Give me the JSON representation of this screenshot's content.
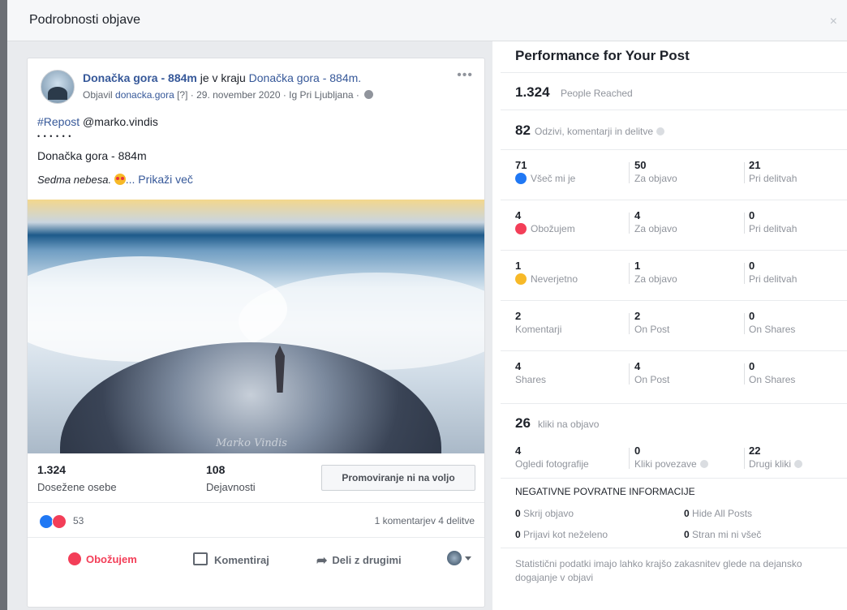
{
  "modal": {
    "title": "Podrobnosti objave",
    "close": "×"
  },
  "post": {
    "author": "Donačka gora - 884m",
    "connector": " je v kraju ",
    "place": "Donačka gora - 884m.",
    "published_by_prefix": "Objavil ",
    "published_by": "donacka.gora",
    "published_meta": " [?] · 29. november 2020 · Ig Pri Ljubljana · ",
    "more": "•••",
    "hashtag": "#Repost",
    "mention": " @marko.vindis",
    "dots": "• • • • • •",
    "line1": "Donačka gora - 884m",
    "italic": "Sedma nebesa. ",
    "see_more": "... Prikaži več",
    "watermark": "Marko Vindis",
    "reached_value": "1.324",
    "reached_label": "Dosežene osebe",
    "engagement_value": "108",
    "engagement_label": "Dejavnosti",
    "promote": "Promoviranje ni na voljo",
    "reaction_count": "53",
    "comments_shares": "1 komentarjev  4 delitve",
    "actions": {
      "love": "Obožujem",
      "comment": "Komentiraj",
      "share": "Deli z drugimi"
    }
  },
  "performance": {
    "title": "Performance for Your Post",
    "reached_value": "1.324",
    "reached_label": "People Reached",
    "engagement_value": "82",
    "engagement_label": "Odzivi, komentarji in delitve",
    "rows": [
      {
        "total": "71",
        "label": "Všeč mi je",
        "icon": "like",
        "post": "50",
        "post_label": "Za objavo",
        "shares": "21",
        "shares_label": "Pri delitvah"
      },
      {
        "total": "4",
        "label": "Obožujem",
        "icon": "love",
        "post": "4",
        "post_label": "Za objavo",
        "shares": "0",
        "shares_label": "Pri delitvah"
      },
      {
        "total": "1",
        "label": "Neverjetno",
        "icon": "wow",
        "post": "1",
        "post_label": "Za objavo",
        "shares": "0",
        "shares_label": "Pri delitvah"
      },
      {
        "total": "2",
        "label": "Komentarji",
        "icon": "",
        "post": "2",
        "post_label": "On Post",
        "shares": "0",
        "shares_label": "On Shares"
      },
      {
        "total": "4",
        "label": "Shares",
        "icon": "",
        "post": "4",
        "post_label": "On Post",
        "shares": "0",
        "shares_label": "On Shares"
      }
    ],
    "clicks_value": "26",
    "clicks_label": "kliki na objavo",
    "clicks": [
      {
        "n": "4",
        "l": "Ogledi fotografije"
      },
      {
        "n": "0",
        "l": "Kliki povezave"
      },
      {
        "n": "22",
        "l": "Drugi kliki"
      }
    ],
    "negative_title": "NEGATIVNE POVRATNE INFORMACIJE",
    "negative": [
      {
        "n": "0",
        "l": " Skrij objavo"
      },
      {
        "n": "0",
        "l": " Hide All Posts"
      },
      {
        "n": "0",
        "l": " Prijavi kot neželeno"
      },
      {
        "n": "0",
        "l": " Stran mi ni všeč"
      }
    ],
    "footnote": "Statistični podatki imajo lahko krajšo zakasnitev glede na dejansko dogajanje v objavi"
  }
}
